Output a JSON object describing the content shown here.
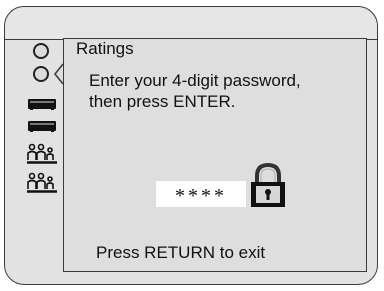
{
  "dialog": {
    "title": "Ratings",
    "message_line1": "Enter your 4-digit password,",
    "message_line2": "then press ENTER.",
    "password_mask": "****",
    "footer": "Press RETURN to exit"
  },
  "sidebar": {
    "icons": [
      "circle-icon",
      "circle-selected-icon",
      "vcr-icon",
      "vcr-icon",
      "family-icon",
      "family-icon"
    ],
    "selected_index": 1
  },
  "colors": {
    "panel": "#e2e2e2",
    "dialog": "#dedede",
    "border": "#3a3a3a",
    "input": "#ffffff"
  }
}
